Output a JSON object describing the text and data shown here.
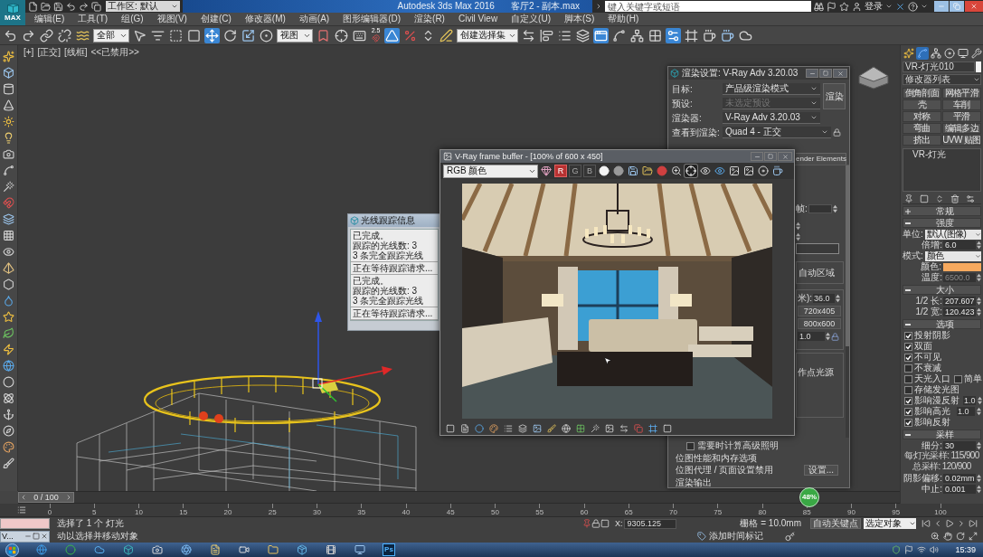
{
  "title_bar": {
    "logo": "MAX",
    "workspace": "工作区: 默认",
    "app_title": "Autodesk 3ds Max 2016",
    "file_name": "客厅2 - 副本.max",
    "search": {
      "placeholder": "键入关键字或短语"
    },
    "sign_in": "登录"
  },
  "menu_bar": [
    "编辑(E)",
    "工具(T)",
    "组(G)",
    "视图(V)",
    "创建(C)",
    "修改器(M)",
    "动画(A)",
    "图形编辑器(D)",
    "渲染(R)",
    "Civil View",
    "自定义(U)",
    "脚本(S)",
    "帮助(H)"
  ],
  "main_toolbar": [
    {
      "kind": "undo",
      "selected": false
    },
    {
      "kind": "redo",
      "selected": false
    },
    {
      "kind": "link",
      "selected": false
    },
    {
      "kind": "unlink",
      "selected": false
    },
    {
      "kind": "bind",
      "selected": false
    },
    {
      "kind": "dropdown",
      "value": "全部",
      "selected": false
    },
    {
      "kind": "select",
      "selected": false
    },
    {
      "kind": "select_by_name",
      "selected": false
    },
    {
      "kind": "rect_region",
      "selected": false
    },
    {
      "kind": "window_crossing",
      "selected": false
    },
    {
      "kind": "move",
      "selected": true
    },
    {
      "kind": "rotate",
      "selected": false
    },
    {
      "kind": "scale",
      "selected": false
    },
    {
      "kind": "placement",
      "selected": false
    },
    {
      "kind": "dropdown",
      "value": "视图",
      "selected": false
    },
    {
      "kind": "pivot",
      "selected": false
    },
    {
      "kind": "manipulate",
      "selected": false
    },
    {
      "kind": "keyboard",
      "selected": false
    },
    {
      "kind": "snap",
      "label": "2.5",
      "selected": false
    },
    {
      "kind": "angle_snap",
      "selected": true
    },
    {
      "kind": "percent_snap",
      "selected": false
    },
    {
      "kind": "spinner_snap",
      "selected": false
    },
    {
      "kind": "edit_named",
      "selected": false
    },
    {
      "kind": "dropdown",
      "value": "创建选择集",
      "selected": false
    },
    {
      "kind": "mirror",
      "selected": false
    },
    {
      "kind": "align",
      "selected": false
    },
    {
      "kind": "scene_explorer",
      "selected": false
    },
    {
      "kind": "layers",
      "selected": false
    },
    {
      "kind": "ribbon",
      "selected": true
    },
    {
      "kind": "curve_editor",
      "selected": false
    },
    {
      "kind": "schematic",
      "selected": false
    },
    {
      "kind": "material",
      "selected": false
    },
    {
      "kind": "render_setup",
      "selected": true
    },
    {
      "kind": "frame_window",
      "selected": false
    },
    {
      "kind": "render",
      "selected": false
    },
    {
      "kind": "render_iterative",
      "selected": false
    },
    {
      "kind": "render_cloud",
      "selected": false
    }
  ],
  "viewport": {
    "labels": [
      "[+]",
      "[正交]",
      "[线框]",
      "<<已禁用>>"
    ]
  },
  "progress_window": {
    "title": "光线跟踪信息",
    "blocks": [
      [
        "已完成。",
        "跟踪的光线数: 3",
        "3 条完全跟踪光线"
      ],
      [
        "正在等待跟踪请求..."
      ],
      [
        "已完成。",
        "跟踪的光线数: 3",
        "3 条完全跟踪光线"
      ],
      [
        "正在等待跟踪请求..."
      ]
    ]
  },
  "render_setup": {
    "title": "渲染设置: V-Ray Adv 3.20.03",
    "fields": [
      {
        "label": "目标:",
        "value": "产品级渲染模式",
        "disabled": false
      },
      {
        "label": "预设:",
        "value": "未选定预设",
        "disabled": true
      },
      {
        "label": "渲染器:",
        "value": "V-Ray Adv 3.20.03",
        "disabled": false
      },
      {
        "label": "查看到渲染:",
        "value": "Quad 4 - 正交",
        "disabled": false
      }
    ],
    "render_button": "渲染",
    "tab": "ender Elements",
    "frame_label": "帧:",
    "region_label": "自动区域",
    "aperture": {
      "label": "米):",
      "value": "36.0"
    },
    "size_presets": [
      "720x405",
      "800x600"
    ],
    "pixel_aspect": "1.0",
    "point_light_label": "作点光源",
    "advanced_lighting": {
      "label": "需要时计算高级照明",
      "checked": false
    },
    "bitmap_group": "位图性能和内存选项",
    "bitmap_text": "位图代理 / 页面设置禁用",
    "setup_button": "设置...",
    "output_group": "渲染输出"
  },
  "frame_buffer": {
    "title": "V-Ray frame buffer - [100% of 600 x 450]",
    "channel_dropdown": "RGB 颜色",
    "tools": [
      {
        "kind": "color_sphere",
        "selected": false
      },
      {
        "kind": "channel",
        "label": "R",
        "selected": true
      },
      {
        "kind": "channel",
        "label": "G",
        "selected": false
      },
      {
        "kind": "channel",
        "label": "B",
        "selected": false
      },
      {
        "kind": "white_dot",
        "selected": false
      },
      {
        "kind": "grey_dot",
        "selected": false
      },
      {
        "kind": "save",
        "selected": false
      },
      {
        "kind": "open",
        "selected": false
      },
      {
        "kind": "red_dot",
        "selected": false
      },
      {
        "kind": "zoom",
        "selected": false
      },
      {
        "kind": "track",
        "selected": true
      },
      {
        "kind": "eye",
        "selected": false
      },
      {
        "kind": "eye_blue",
        "selected": false
      },
      {
        "kind": "image",
        "selected": false
      },
      {
        "kind": "image",
        "selected": false
      },
      {
        "kind": "disc",
        "selected": false
      },
      {
        "kind": "cup",
        "selected": false
      }
    ]
  },
  "command_panel": {
    "tabs": [
      {
        "kind": "create",
        "selected": false
      },
      {
        "kind": "modify",
        "selected": true
      },
      {
        "kind": "hierarchy",
        "selected": false
      },
      {
        "kind": "motion",
        "selected": false
      },
      {
        "kind": "display",
        "selected": false
      },
      {
        "kind": "utilities",
        "selected": false
      }
    ],
    "object_name": "VR-灯光010",
    "modifier_list": "修改器列表",
    "modifier_buttons": [
      "倒角剖面",
      "网格平滑",
      "壳",
      "车削",
      "对称",
      "平滑",
      "弯曲",
      "编辑多边",
      "挤出",
      "UVW 贴图"
    ],
    "stack": [
      "VR-灯光"
    ],
    "rollouts": [
      {
        "title": "常规",
        "expanded": false
      },
      {
        "title": "强度",
        "expanded": true,
        "params": [
          {
            "kind": "dropdown",
            "label": "单位:",
            "value": "默认(图像)"
          },
          {
            "kind": "spinner",
            "label": "倍增:",
            "value": "6.0",
            "disabled": false
          },
          {
            "kind": "dropdown",
            "label": "模式:",
            "value": "颜色"
          },
          {
            "kind": "swatch",
            "label": "颜色:",
            "color": "#f6a95e"
          },
          {
            "kind": "spinner",
            "label": "温度:",
            "value": "6500.0",
            "disabled": true
          }
        ]
      },
      {
        "title": "大小",
        "expanded": true,
        "params": [
          {
            "kind": "spinner",
            "label": "1/2 长:",
            "value": "207.607",
            "disabled": false
          },
          {
            "kind": "spinner",
            "label": "1/2 宽:",
            "value": "120.423",
            "disabled": false
          }
        ]
      },
      {
        "title": "选项",
        "expanded": true,
        "params": [
          {
            "kind": "checkbox",
            "label": "投射阴影",
            "checked": true
          },
          {
            "kind": "checkbox",
            "label": "双面",
            "checked": true
          },
          {
            "kind": "checkbox",
            "label": "不可见",
            "checked": true
          },
          {
            "kind": "checkbox",
            "label": "不衰减",
            "checked": false
          },
          {
            "kind": "checkbox",
            "label": "天光入口",
            "checked": false,
            "pair": {
              "label": "简单",
              "checked": false
            }
          },
          {
            "kind": "checkbox",
            "label": "存储发光图",
            "checked": false
          },
          {
            "kind": "checkbox",
            "label": "影响漫反射",
            "checked": true,
            "value": "1.0"
          },
          {
            "kind": "checkbox",
            "label": "影响高光",
            "checked": true,
            "value": "1.0"
          },
          {
            "kind": "checkbox",
            "label": "影响反射",
            "checked": true
          }
        ]
      },
      {
        "title": "采样",
        "expanded": true,
        "params": [
          {
            "kind": "spinner",
            "label": "细分:",
            "value": "30",
            "disabled": false
          },
          {
            "kind": "note",
            "label": "每灯光采样: 115/900"
          },
          {
            "kind": "note",
            "label": "总采样: 120/900"
          },
          {
            "kind": "spinner",
            "label": "阴影偏移:",
            "value": "0.02mm",
            "disabled": false
          },
          {
            "kind": "spinner",
            "label": "中止:",
            "value": "0.001",
            "disabled": false
          }
        ]
      }
    ]
  },
  "time_slider": {
    "position": "0 / 100",
    "level": 0
  },
  "track_bar": {
    "ticks": [
      "0",
      "5",
      "10",
      "15",
      "20",
      "25",
      "30",
      "35",
      "40",
      "45",
      "50",
      "55",
      "60",
      "65",
      "70",
      "75",
      "80",
      "85",
      "90",
      "95",
      "100"
    ]
  },
  "status_bar": {
    "selection": "选择了 1 个 灯光",
    "x_label": "X:",
    "x_value": "9305.125",
    "grid": "栅格 = 10.0mm",
    "auto_key": "自动关键点",
    "key_mode": "选定对象",
    "listener": "V...",
    "prompt": "动以选择并移动对象",
    "time_tag": "添加时间标记"
  },
  "network_ball": {
    "percent": "48%"
  },
  "taskbar": {
    "apps": [
      {
        "kind": "ie"
      },
      {
        "kind": "browser"
      },
      {
        "kind": "cloud"
      },
      {
        "kind": "max"
      },
      {
        "kind": "camera"
      },
      {
        "kind": "aperture"
      },
      {
        "kind": "notes"
      },
      {
        "kind": "video"
      },
      {
        "kind": "folder"
      },
      {
        "kind": "package"
      },
      {
        "kind": "film"
      },
      {
        "kind": "monitor"
      },
      {
        "kind": "ps",
        "label": "Ps"
      }
    ],
    "clock": "15:39"
  }
}
